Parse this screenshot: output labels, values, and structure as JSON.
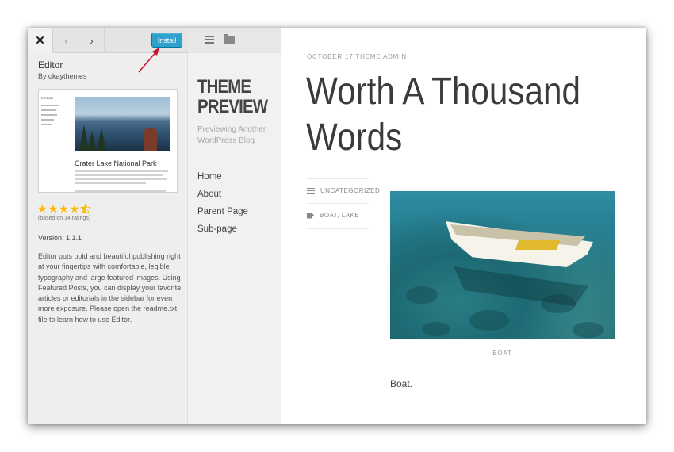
{
  "customizer": {
    "close": "✕",
    "prev": "‹",
    "next": "›",
    "install_label": "Install",
    "theme_name": "Editor",
    "theme_author": "By okaythemes",
    "screenshot_title": "Crater Lake National Park",
    "screenshot_sidebar_title": "EDITOR",
    "rating": {
      "stars": 4.5,
      "max": 5,
      "label": "(based on 14 ratings)"
    },
    "version": "Version: 1.1.1",
    "description": "Editor puts bold and beautiful publishing right at your fingertips with comfortable, legible typography and large featured images. Using Featured Posts, you can display your favorite articles or editorials in the sidebar for even more exposure. Please open the readme.txt file to learn how to use Editor."
  },
  "preview": {
    "site_title": "THEME PREVIEW",
    "tagline": "Previewing Another WordPress Blog",
    "nav": [
      "Home",
      "About",
      "Parent Page",
      "Sub-page"
    ],
    "post": {
      "meta": "OCTOBER 17 THEME ADMIN",
      "title": "Worth A Thousand Words",
      "category": "UNCATEGORIZED",
      "tags": "BOAT, LAKE",
      "image_caption": "BOAT",
      "body": "Boat."
    }
  },
  "colors": {
    "install_button": "#2ea2cc",
    "annotation_arrow": "#c8102e",
    "star": "#ffb900"
  },
  "icons": {
    "close": "close-icon",
    "prev": "chevron-left-icon",
    "next": "chevron-right-icon",
    "menu": "menu-icon",
    "folder": "folder-icon",
    "category": "list-icon",
    "tag": "tag-icon"
  }
}
